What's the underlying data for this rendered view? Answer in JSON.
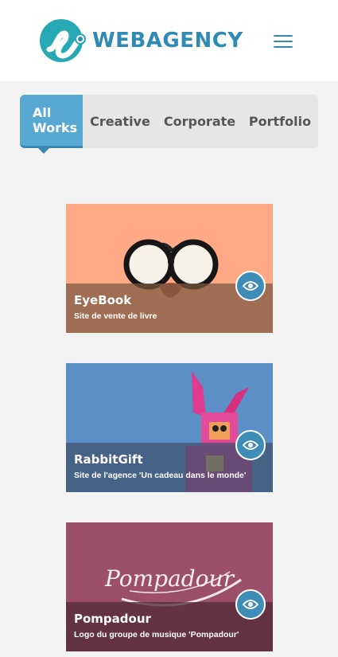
{
  "header": {
    "brand": "WEBAGENCY",
    "logo_icon": "webagency-logo-icon",
    "menu_icon": "hamburger-menu-icon",
    "brand_color": "#2f8bb5"
  },
  "filters": {
    "tabs": [
      {
        "label_line1": "All",
        "label_line2": "Works",
        "active": true
      },
      {
        "label": "Creative"
      },
      {
        "label": "Corporate"
      },
      {
        "label": "Portfolio"
      }
    ],
    "active_color": "#57a9d2"
  },
  "projects": [
    {
      "title": "EyeBook",
      "description": "Site de vente de livre",
      "background": "#ffa986",
      "action_icon": "eye-icon"
    },
    {
      "title": "RabbitGift",
      "description": "Site de l'agence 'Un cadeau dans le monde'",
      "background": "#5b8fc6",
      "action_icon": "eye-icon"
    },
    {
      "title": "Pompadour",
      "description": "Logo du groupe de musique 'Pompadour'",
      "background": "#9b4f68",
      "action_icon": "eye-icon",
      "artwork_text": "Pompadour"
    }
  ]
}
